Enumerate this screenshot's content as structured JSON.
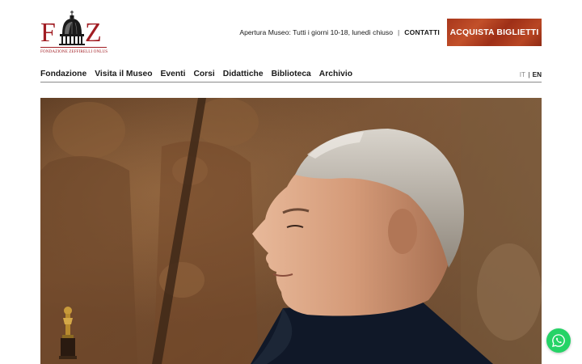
{
  "logo": {
    "letters_left": "F",
    "letters_right": "Z",
    "subtitle": "FONDAZIONE ZEFFIRELLI ONLUS",
    "color": "#a11d23"
  },
  "header": {
    "opening_hours": "Apertura Museo: Tutti i giorni 10-18, lunedì chiuso",
    "separator": "|",
    "contact_label": "CONTATTI",
    "tickets_button": "ACQUISTA BIGLIETTI",
    "tickets_color": "#b0401f"
  },
  "nav": {
    "items": [
      {
        "label": "Fondazione"
      },
      {
        "label": "Visita il Museo"
      },
      {
        "label": "Eventi"
      },
      {
        "label": "Corsi"
      },
      {
        "label": "Didattiche"
      },
      {
        "label": "Biblioteca"
      },
      {
        "label": "Archivio"
      }
    ]
  },
  "language": {
    "it": "IT",
    "separator": "|",
    "en": "EN",
    "active": "EN"
  },
  "hero": {
    "image": "portrait-photo",
    "icon": "oscar-statuette-icon"
  },
  "chat": {
    "icon": "whatsapp-icon",
    "color": "#25d366"
  }
}
